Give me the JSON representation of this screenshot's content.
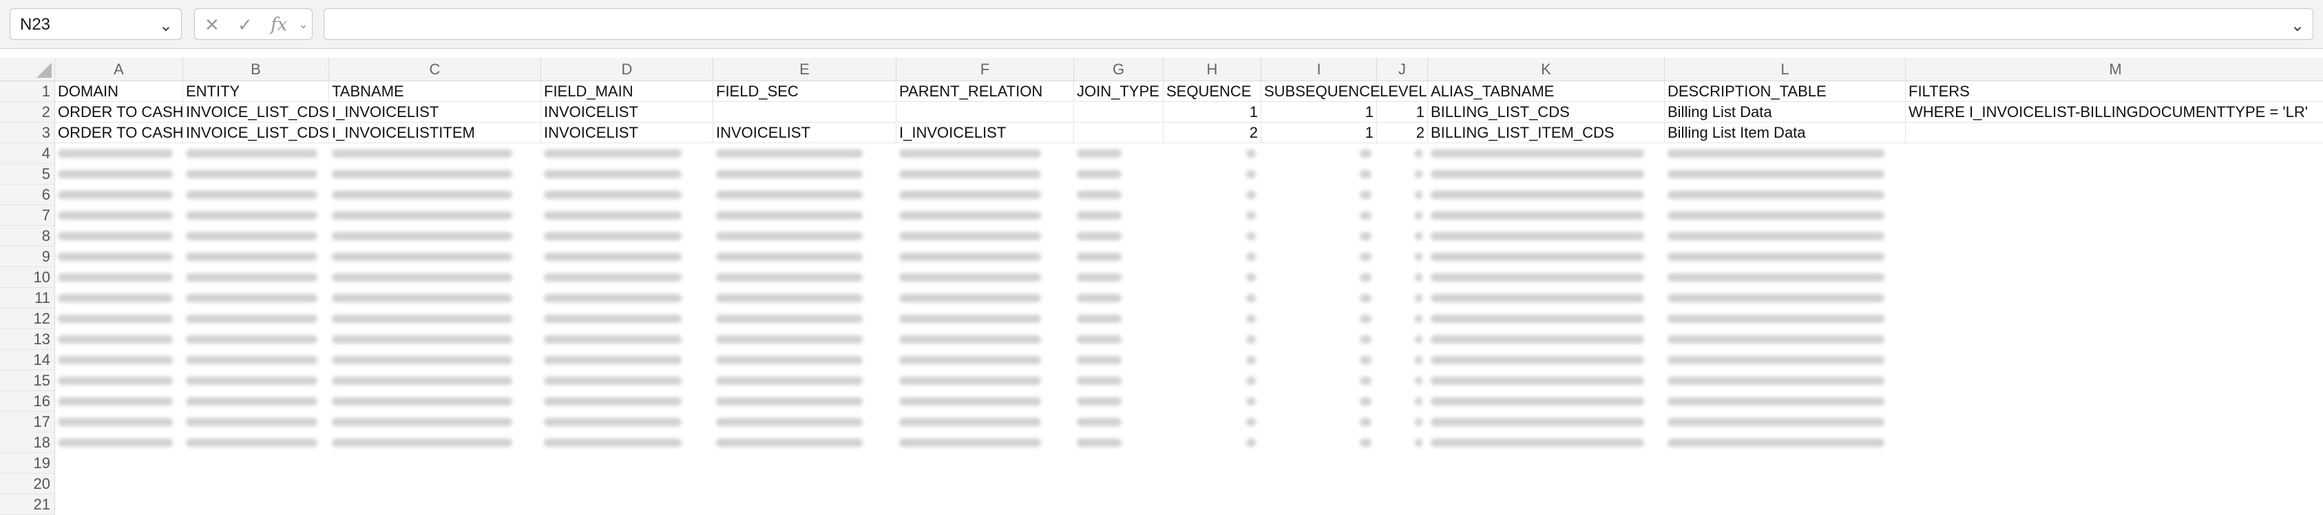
{
  "name_box": {
    "value": "N23",
    "dropdown_icon": "chevron-down-icon"
  },
  "formula_bar": {
    "cancel_icon": "close-icon",
    "confirm_icon": "check-icon",
    "function_icon": "fx-icon",
    "fx_label": "fx",
    "value": ""
  },
  "columns": [
    "A",
    "B",
    "C",
    "D",
    "E",
    "F",
    "G",
    "H",
    "I",
    "J",
    "K",
    "L",
    "M"
  ],
  "rows": [
    [
      "DOMAIN",
      "ENTITY",
      "TABNAME",
      "FIELD_MAIN",
      "FIELD_SEC",
      "PARENT_RELATION",
      "JOIN_TYPE",
      "SEQUENCE",
      "SUBSEQUENCE",
      "LEVEL",
      "ALIAS_TABNAME",
      "DESCRIPTION_TABLE",
      "FILTERS"
    ],
    [
      "ORDER TO CASH",
      "INVOICE_LIST_CDS",
      "I_INVOICELIST",
      "INVOICELIST",
      "",
      "",
      "",
      "1",
      "1",
      "1",
      "BILLING_LIST_CDS",
      "Billing List Data",
      "WHERE I_INVOICELIST-BILLINGDOCUMENTTYPE = 'LR'"
    ],
    [
      "ORDER TO CASH",
      "INVOICE_LIST_CDS",
      "I_INVOICELISTITEM",
      "INVOICELIST",
      "INVOICELIST",
      "I_INVOICELIST",
      "",
      "2",
      "1",
      "2",
      "BILLING_LIST_ITEM_CDS",
      "Billing List Item Data",
      ""
    ]
  ],
  "row_numbers": [
    "1",
    "2",
    "3",
    "4",
    "5",
    "6",
    "7",
    "8",
    "9",
    "10",
    "11",
    "12",
    "13",
    "14",
    "15",
    "16",
    "17",
    "18",
    "19",
    "20",
    "21"
  ]
}
